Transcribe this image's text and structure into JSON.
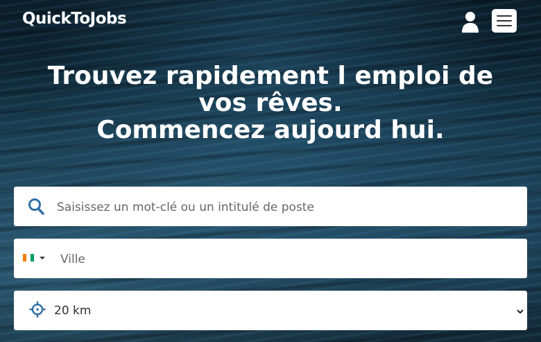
{
  "header": {
    "logo_text": "QuickToJobs",
    "user_icon": "user-icon",
    "menu_icon": "hamburger-menu-icon"
  },
  "hero": {
    "title_line1": "Trouvez rapidement l emploi de",
    "title_line2": "vos rêves.",
    "title_line3": "Commencez aujourd hui."
  },
  "search": {
    "keyword_placeholder": "Saisissez un mot-clé ou un intitulé de poste",
    "keyword_icon": "search-icon",
    "city_placeholder": "Ville",
    "country_flag_icon": "ivory-coast-flag-icon",
    "radius_selected": "20 km",
    "radius_icon": "crosshair-target-icon"
  },
  "colors": {
    "accent": "#2f6fa5",
    "field_bg": "#ffffff",
    "flag_orange": "#f77f00",
    "flag_white": "#ffffff",
    "flag_green": "#009e60"
  }
}
